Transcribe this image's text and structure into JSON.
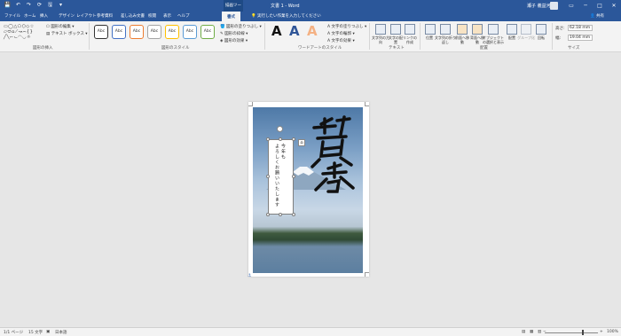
{
  "window": {
    "title": "文書 1 - Word",
    "context_tab": "描画ツール",
    "user": "瀬子 義益河",
    "min": "─",
    "max": "□",
    "close": "✕"
  },
  "quick_access": [
    "💾",
    "↶",
    "↷",
    "⟳",
    "🖫",
    "▾"
  ],
  "tabs": [
    "ファイル",
    "ホーム",
    "挿入",
    "デザイン",
    "レイアウト",
    "参考資料",
    "差し込み文書",
    "校閲",
    "表示",
    "ヘルプ",
    "書式"
  ],
  "tab_ribbon_active": "書式",
  "tell_me": "実行したい作業を入力してください",
  "share": "共有",
  "ribbon": {
    "shapes_group": "図形の挿入",
    "edit_shape": "図形の編集 ▾",
    "text_box": "テキスト ボックス ▾",
    "style_group": "図形のスタイル",
    "style_sample": "Abc",
    "fill": "図形の塗りつぶし ▾",
    "outline": "図形の枠線 ▾",
    "effects": "図形の効果 ▾",
    "wordart_group": "ワードアートのスタイル",
    "text_fill": "文字の塗りつぶし ▾",
    "text_outline": "文字の輪郭 ▾",
    "text_effects": "文字の効果 ▾",
    "text_group": "テキスト",
    "text_dir": "文字列の方向",
    "align_text": "文字の配置",
    "create_link": "リンクの作成",
    "arrange_group": "配置",
    "position": "位置",
    "wrap": "文字列の折り返し",
    "forward": "前面へ移動",
    "backward": "背面へ移動",
    "selection": "オブジェクトの選択と表示",
    "align": "配置",
    "group": "グループ化",
    "rotate": "回転",
    "size_group": "サイズ",
    "height": "62.18 mm",
    "width": "19.04 mm",
    "height_label": "高さ:",
    "width_label": "幅:"
  },
  "document": {
    "lines": [
      "今年も",
      "よろしくお願いいたします"
    ]
  },
  "status": {
    "page": "1/1 ページ",
    "words": "15 文字",
    "lang": "日本語",
    "zoom": "100%"
  }
}
